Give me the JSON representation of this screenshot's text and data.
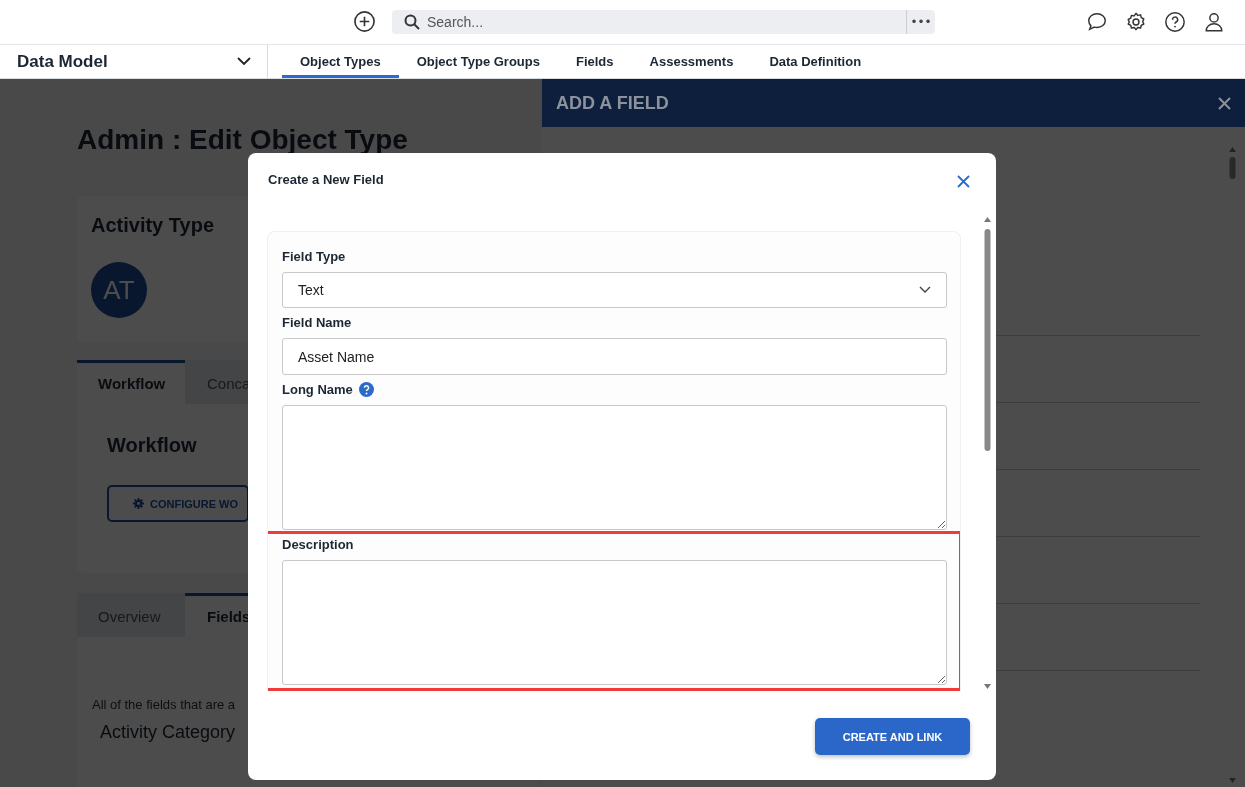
{
  "top_bar": {
    "search": {
      "placeholder": "Search...",
      "more": "•••"
    }
  },
  "nav": {
    "app_switcher": "Data Model",
    "tabs": [
      {
        "label": "Object Types",
        "selected": true
      },
      {
        "label": "Object Type Groups",
        "selected": false
      },
      {
        "label": "Fields",
        "selected": false
      },
      {
        "label": "Assessments",
        "selected": false
      },
      {
        "label": "Data Definition",
        "selected": false
      }
    ]
  },
  "page": {
    "title": "Admin : Edit Object Type",
    "record_card": {
      "title": "Activity Type",
      "avatar": "AT"
    },
    "section_tabs": [
      {
        "label": "Workflow",
        "selected": true
      },
      {
        "label": "Conca",
        "selected": false
      }
    ],
    "section_title": "Workflow",
    "configure_button": "CONFIGURE WO",
    "detail_tabs": [
      {
        "label": "Overview",
        "selected": false
      },
      {
        "label": "Fields",
        "selected": true
      }
    ],
    "intro": "All of the fields that are a",
    "field_name": "Activity Category"
  },
  "side_panel": {
    "title": "ADD A FIELD"
  },
  "dialog": {
    "title": "Create a New Field",
    "fields": [
      {
        "kind": "select",
        "label": "Field Type",
        "value": "Text",
        "help": false,
        "highlighted": false
      },
      {
        "kind": "input",
        "label": "Field Name",
        "value": "Asset Name",
        "help": false,
        "highlighted": false
      },
      {
        "kind": "textarea",
        "label": "Long Name",
        "help": true,
        "highlighted": false
      },
      {
        "kind": "textarea",
        "label": "Description",
        "help": false,
        "highlighted": true
      }
    ],
    "button": "CREATE AND LINK"
  }
}
